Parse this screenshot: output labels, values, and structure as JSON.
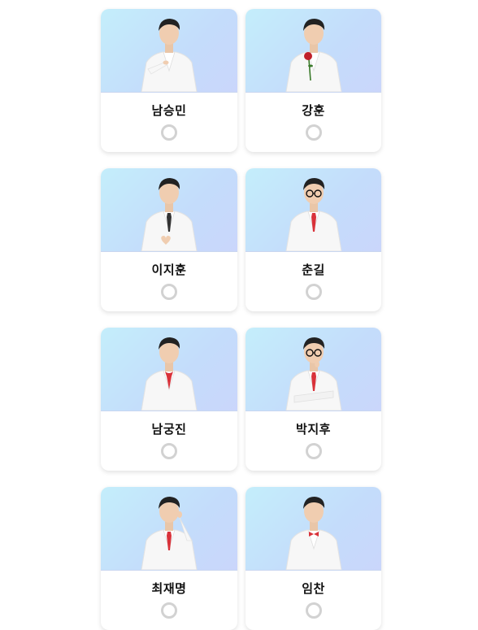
{
  "candidates": [
    {
      "name": "남승민",
      "selected": false,
      "pose": "point",
      "glasses": false,
      "tie": "none",
      "rose": false
    },
    {
      "name": "강훈",
      "selected": false,
      "pose": "rose",
      "glasses": false,
      "tie": "none",
      "rose": true
    },
    {
      "name": "이지훈",
      "selected": false,
      "pose": "heart",
      "glasses": false,
      "tie": "dark",
      "rose": false
    },
    {
      "name": "춘길",
      "selected": false,
      "pose": "stand",
      "glasses": true,
      "tie": "red-pattern",
      "rose": false
    },
    {
      "name": "남궁진",
      "selected": false,
      "pose": "stand",
      "glasses": false,
      "tie": "red-ribbon",
      "rose": false
    },
    {
      "name": "박지후",
      "selected": false,
      "pose": "arms-crossed",
      "glasses": true,
      "tie": "red",
      "rose": false
    },
    {
      "name": "최재명",
      "selected": false,
      "pose": "thinking",
      "glasses": false,
      "tie": "red",
      "rose": false
    },
    {
      "name": "임찬",
      "selected": false,
      "pose": "stand",
      "glasses": false,
      "tie": "red-bow",
      "rose": false
    }
  ],
  "colors": {
    "photo_bg_start": "#c4eefb",
    "photo_bg_end": "#cad6fb",
    "suit": "#f7f7f7",
    "accent_red": "#d9323a",
    "radio_border": "#d2d2d2"
  }
}
